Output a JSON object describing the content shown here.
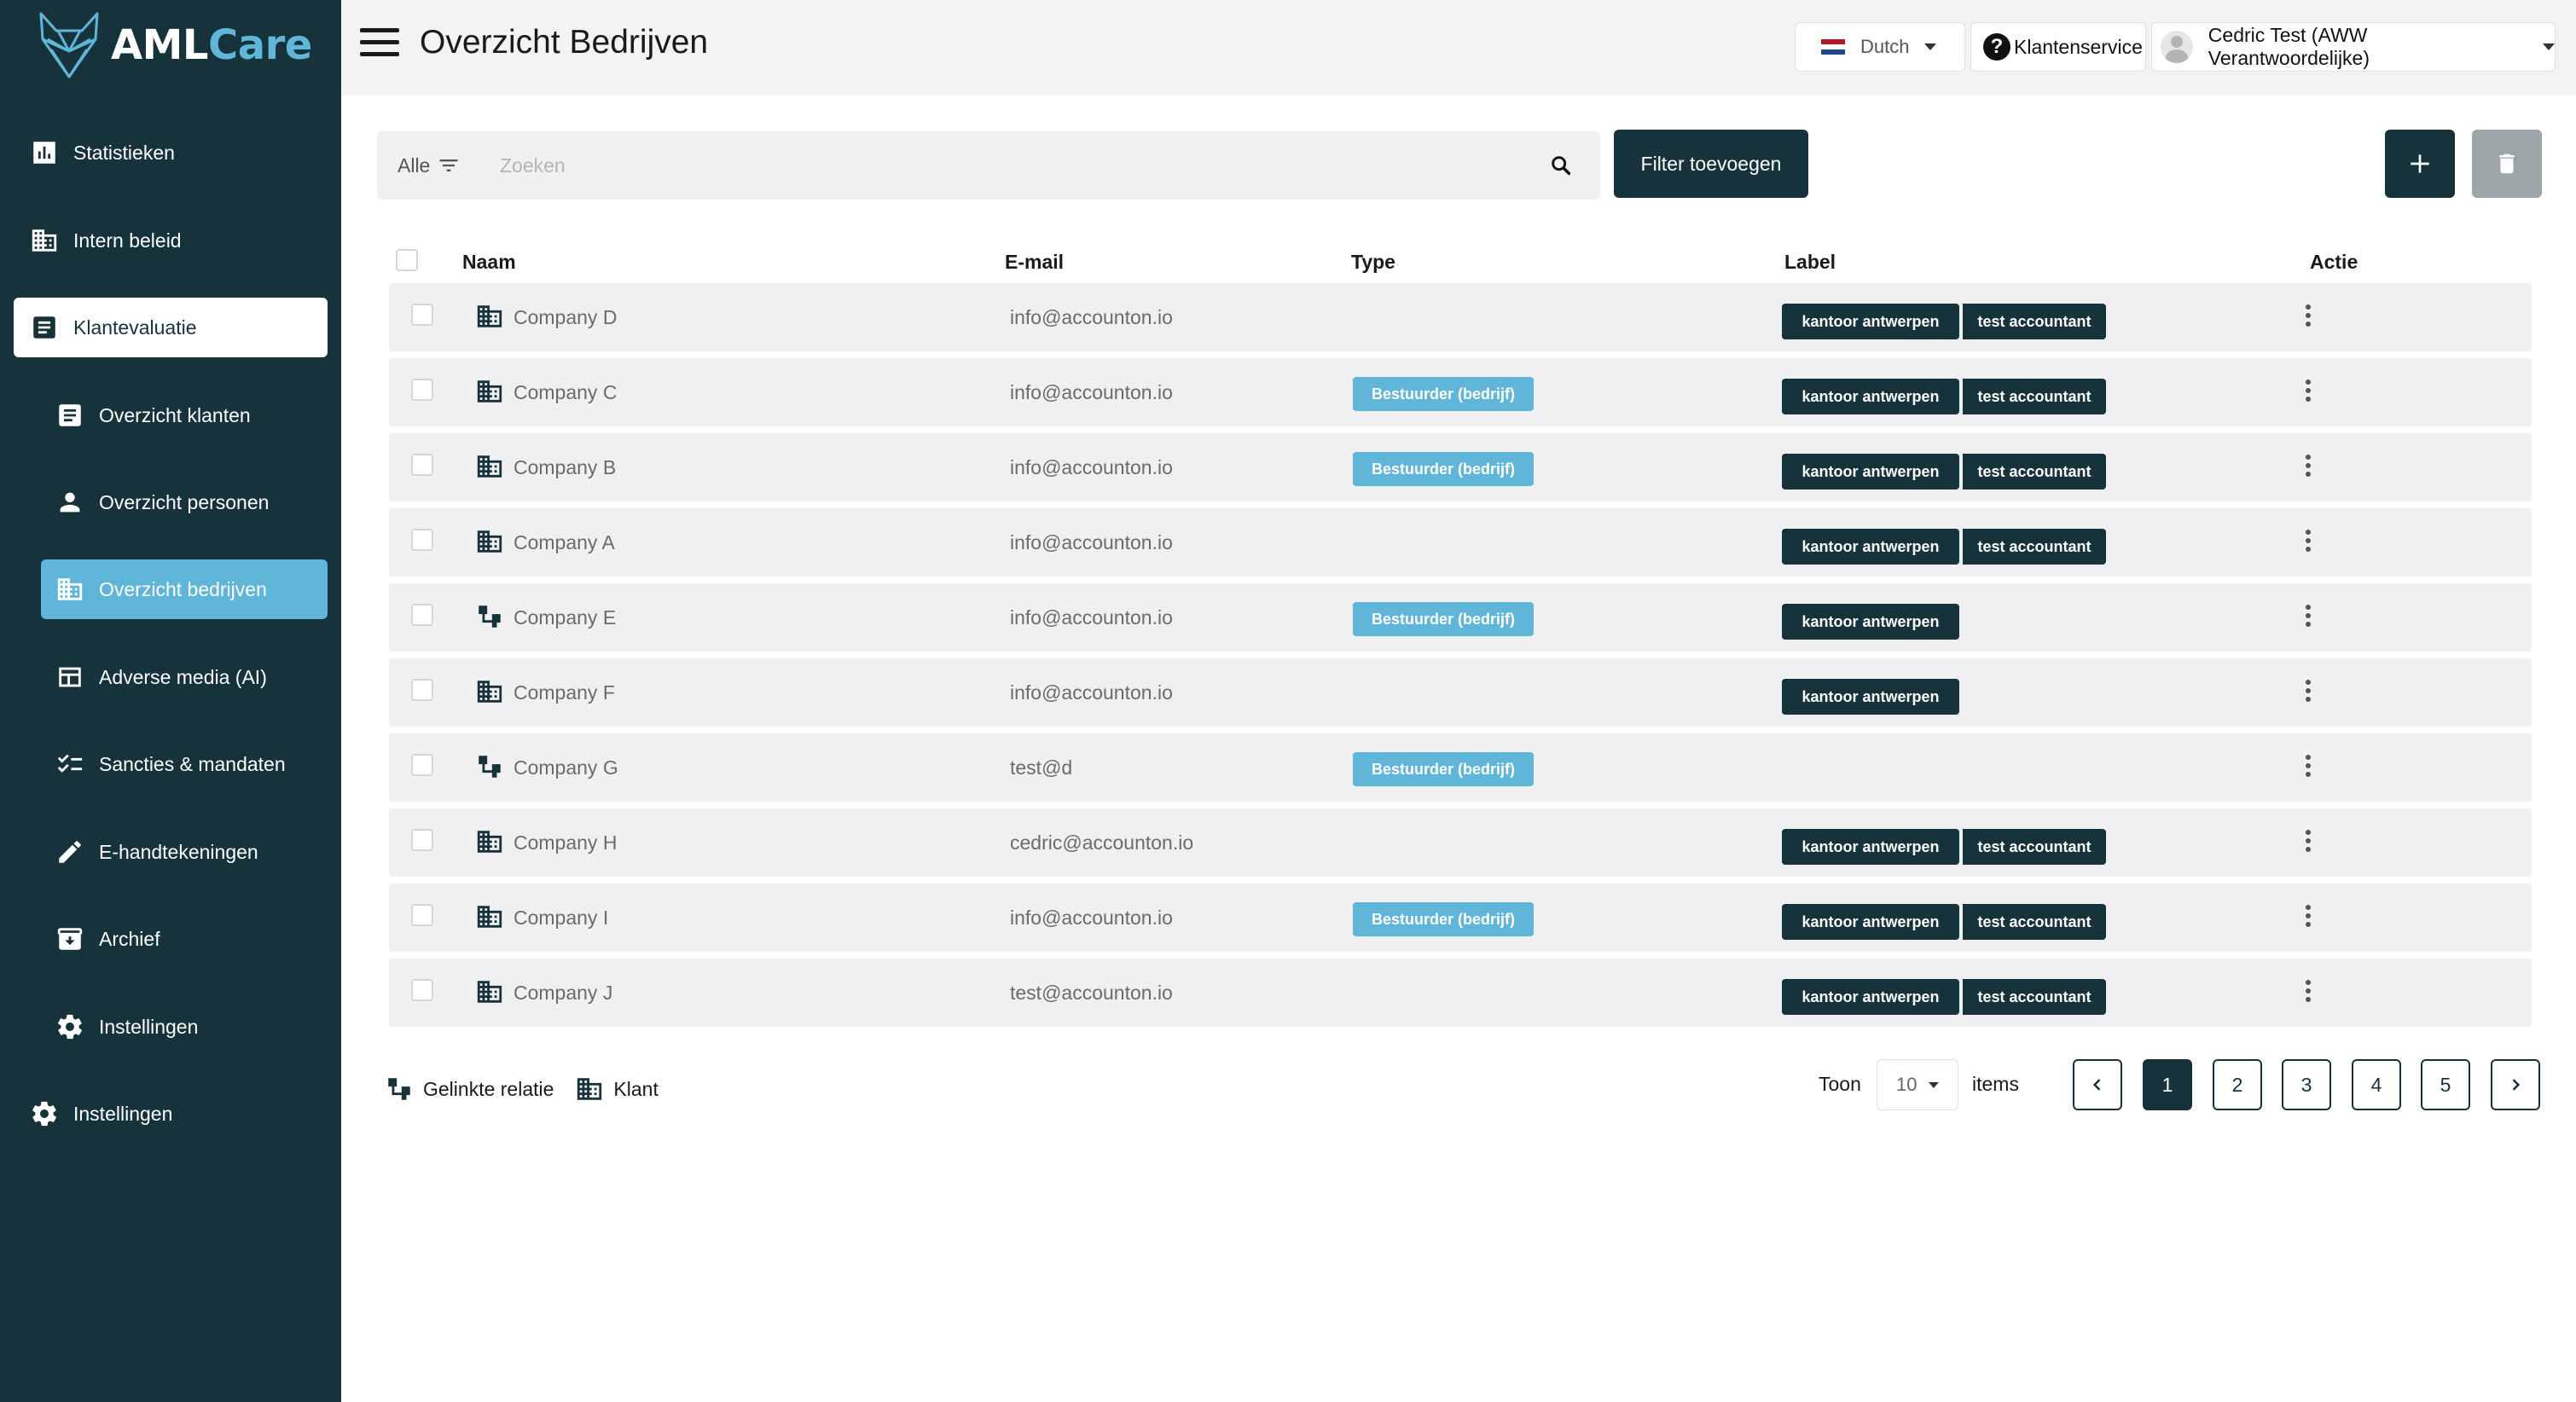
{
  "brand": {
    "name_part1": "AML",
    "name_part2": "Care",
    "accent": "#5fb6d8",
    "dark": "#16333b"
  },
  "sidebar": {
    "items": [
      {
        "label": "Statistieken",
        "icon": "bar-chart-icon"
      },
      {
        "label": "Intern beleid",
        "icon": "building-icon"
      },
      {
        "label": "Klantevaluatie",
        "icon": "document-icon"
      },
      {
        "label": "Overzicht klanten",
        "icon": "document-icon"
      },
      {
        "label": "Overzicht personen",
        "icon": "person-icon"
      },
      {
        "label": "Overzicht bedrijven",
        "icon": "building-icon"
      },
      {
        "label": "Adverse media (AI)",
        "icon": "table-icon"
      },
      {
        "label": "Sancties & mandaten",
        "icon": "checklist-icon"
      },
      {
        "label": "E-handtekeningen",
        "icon": "pencil-icon"
      },
      {
        "label": "Archief",
        "icon": "archive-icon"
      },
      {
        "label": "Instellingen",
        "icon": "gear-icon"
      },
      {
        "label": "Instellingen",
        "icon": "gear-icon"
      }
    ]
  },
  "header": {
    "title": "Overzicht Bedrijven",
    "language": "Dutch",
    "help_label": "Klantenservice",
    "user_name": "Cedric Test (AWW Verantwoordelijke)"
  },
  "toolbar": {
    "filter_scope": "Alle",
    "search_placeholder": "Zoeken",
    "filter_button": "Filter toevoegen"
  },
  "table": {
    "columns": {
      "name": "Naam",
      "email": "E-mail",
      "type": "Type",
      "label": "Label",
      "action": "Actie"
    },
    "rows": [
      {
        "name": "Company D",
        "email": "info@accounton.io",
        "type": "",
        "labels": [
          "kantoor antwerpen",
          "test accountant"
        ],
        "icon": "building-icon"
      },
      {
        "name": "Company C",
        "email": "info@accounton.io",
        "type": "Bestuurder (bedrijf)",
        "labels": [
          "kantoor antwerpen",
          "test accountant"
        ],
        "icon": "building-icon"
      },
      {
        "name": "Company B",
        "email": "info@accounton.io",
        "type": "Bestuurder (bedrijf)",
        "labels": [
          "kantoor antwerpen",
          "test accountant"
        ],
        "icon": "building-icon"
      },
      {
        "name": "Company A",
        "email": "info@accounton.io",
        "type": "",
        "labels": [
          "kantoor antwerpen",
          "test accountant"
        ],
        "icon": "building-icon"
      },
      {
        "name": "Company E",
        "email": "info@accounton.io",
        "type": "Bestuurder (bedrijf)",
        "labels": [
          "kantoor antwerpen"
        ],
        "icon": "linked-relation-icon"
      },
      {
        "name": "Company F",
        "email": "info@accounton.io",
        "type": "",
        "labels": [
          "kantoor antwerpen"
        ],
        "icon": "building-icon"
      },
      {
        "name": "Company G",
        "email": "test@d",
        "type": "Bestuurder (bedrijf)",
        "labels": [],
        "icon": "linked-relation-icon"
      },
      {
        "name": "Company H",
        "email": "cedric@accounton.io",
        "type": "",
        "labels": [
          "kantoor antwerpen",
          "test accountant"
        ],
        "icon": "building-icon"
      },
      {
        "name": "Company I",
        "email": "info@accounton.io",
        "type": "Bestuurder (bedrijf)",
        "labels": [
          "kantoor antwerpen",
          "test accountant"
        ],
        "icon": "building-icon"
      },
      {
        "name": "Company J",
        "email": "test@accounton.io",
        "type": "",
        "labels": [
          "kantoor antwerpen",
          "test accountant"
        ],
        "icon": "building-icon"
      }
    ]
  },
  "legend": {
    "linked": "Gelinkte relatie",
    "client": "Klant"
  },
  "pagination": {
    "show_label": "Toon",
    "page_size": "10",
    "items_label": "items",
    "pages": [
      "1",
      "2",
      "3",
      "4",
      "5"
    ],
    "current": "1"
  }
}
